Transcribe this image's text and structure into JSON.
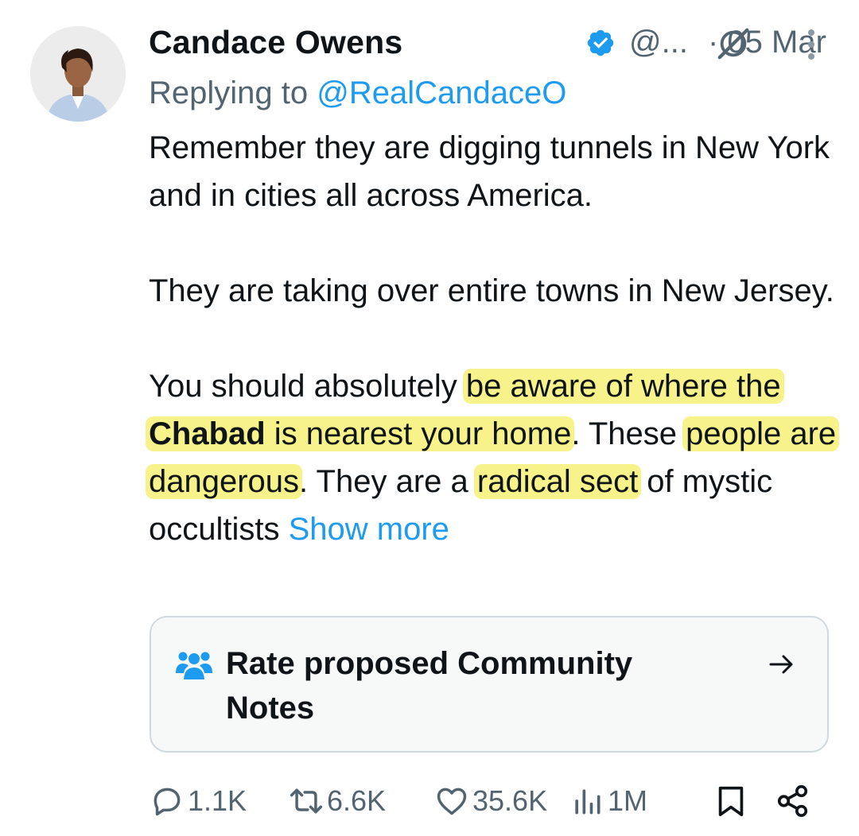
{
  "tweet": {
    "author_name": "Candace Owens",
    "handle": "@...",
    "date": "· 05 Mar",
    "replying_prefix": "Replying to ",
    "replying_mention": "@RealCandaceO",
    "paragraph1": "Remember they are digging tunnels in New York and in cities all across America.",
    "paragraph2": "They are taking over entire towns in New Jersey.",
    "p3_part1": "You should absolutely ",
    "p3_hl1_part1": "be aware of where the ",
    "p3_hl1_bold": "Chabad",
    "p3_hl1_part2": " is nearest your home",
    "p3_part2": ". These ",
    "p3_hl2": "people are dangerous",
    "p3_part3": ". They are a ",
    "p3_hl3": "radical sect",
    "p3_part4": " of mystic occultists ",
    "show_more": "Show more",
    "highlight_color": "#f7f28a",
    "link_color": "#1d9bf0"
  },
  "community_notes": {
    "label": "Rate proposed Community Notes",
    "icon": "people-icon",
    "arrow_icon": "arrow-right-icon"
  },
  "actions": {
    "replies": "1.1K",
    "reposts": "6.6K",
    "likes": "35.6K",
    "views": "1M"
  }
}
